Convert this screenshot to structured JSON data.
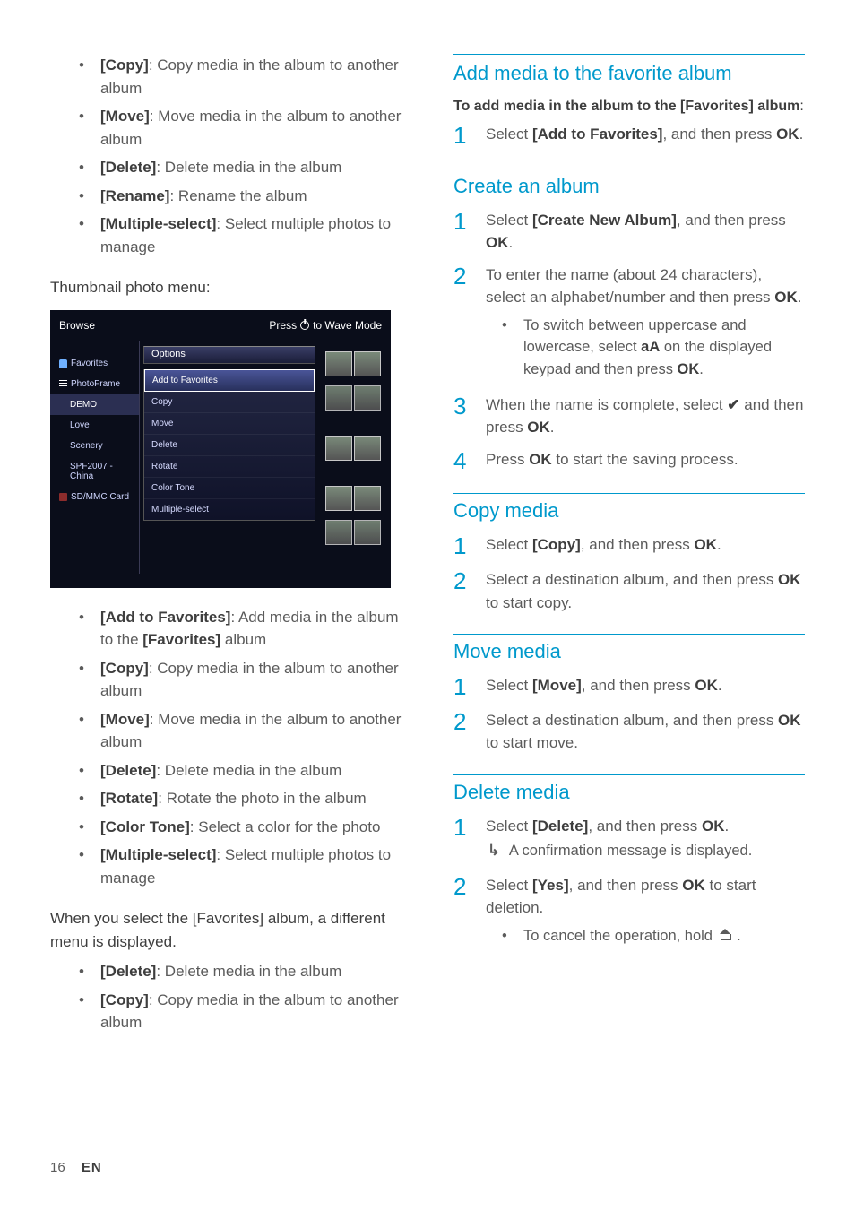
{
  "col1": {
    "list1": [
      {
        "label": "[Copy]",
        "desc": ": Copy media in the album to another album"
      },
      {
        "label": "[Move]",
        "desc": ": Move media in the album to another album"
      },
      {
        "label": "[Delete]",
        "desc": ": Delete media in the album"
      },
      {
        "label": "[Rename]",
        "desc": ": Rename the album"
      },
      {
        "label": "[Multiple-select]",
        "desc": ": Select multiple photos to manage"
      }
    ],
    "thumb_menu_title": "Thumbnail photo menu:",
    "screenshot": {
      "topLeft": "Browse",
      "topRight": "Press        to Wave Mode",
      "left": [
        {
          "label": "Favorites",
          "style": "fav"
        },
        {
          "label": "PhotoFrame",
          "style": "photo"
        },
        {
          "label": "DEMO",
          "style": "indent hl"
        },
        {
          "label": "Love",
          "style": "indent"
        },
        {
          "label": "Scenery",
          "style": "indent"
        },
        {
          "label": "SPF2007 -China",
          "style": "indent"
        },
        {
          "label": "SD/MMC Card",
          "style": "stor"
        }
      ],
      "optionsTitle": "Options",
      "options": [
        "Add to Favorites",
        "Copy",
        "Move",
        "Delete",
        "Rotate",
        "Color Tone",
        "Multiple-select"
      ]
    },
    "list2": [
      {
        "label": "[Add to Favorites]",
        "desc": ": Add media in the album to the ",
        "desc2": "[Favorites]",
        "desc3": " album"
      },
      {
        "label": "[Copy]",
        "desc": ": Copy media in the album to another album"
      },
      {
        "label": "[Move]",
        "desc": ": Move media in the album to another album"
      },
      {
        "label": "[Delete]",
        "desc": ": Delete media in the album"
      },
      {
        "label": "[Rotate]",
        "desc": ": Rotate the photo in the album"
      },
      {
        "label": "[Color Tone]",
        "desc": ": Select a color for the photo"
      },
      {
        "label": "[Multiple-select]",
        "desc": ": Select multiple photos to manage"
      }
    ],
    "fav_note": "When you select the [Favorites] album, a different menu is displayed.",
    "list3": [
      {
        "label": "[Delete]",
        "desc": ": Delete media in the album"
      },
      {
        "label": "[Copy]",
        "desc": ": Copy media in the album to another album"
      }
    ]
  },
  "col2": {
    "s1": {
      "h": "Add media to the favorite album",
      "intro1": "To add media in the album to the ",
      "intro2": "[Favorites]",
      "intro3": " album",
      "step1a": "Select ",
      "step1b": "[Add to Favorites]",
      "step1c": ", and then press ",
      "step1d": "OK",
      "step1e": "."
    },
    "s2": {
      "h": "Create an album",
      "st1a": "Select ",
      "st1b": "[Create New Album]",
      "st1c": ", and then press ",
      "st1d": "OK",
      "st1e": ".",
      "st2a": "To enter the name (about 24 characters), select an alphabet/number and then press ",
      "st2b": "OK",
      "st2c": ".",
      "sub1a": "To switch between uppercase and lowercase, select ",
      "sub1b": "aA",
      "sub1c": " on the displayed keypad and then press ",
      "sub1d": "OK",
      "sub1e": ".",
      "st3a": "When the name is complete, select ",
      "st3c": " and then press ",
      "st3d": "OK",
      "st3e": ".",
      "st4a": "Press ",
      "st4b": "OK",
      "st4c": " to start the saving process."
    },
    "s3": {
      "h": "Copy media",
      "st1a": "Select ",
      "st1b": "[Copy]",
      "st1c": ", and then press ",
      "st1d": "OK",
      "st1e": ".",
      "st2a": "Select a destination album, and then press ",
      "st2b": "OK",
      "st2c": " to start copy."
    },
    "s4": {
      "h": "Move media",
      "st1a": "Select ",
      "st1b": "[Move]",
      "st1c": ", and then press ",
      "st1d": "OK",
      "st1e": ".",
      "st2a": "Select a destination album, and then press ",
      "st2b": "OK",
      "st2c": " to start move."
    },
    "s5": {
      "h": "Delete media",
      "st1a": "Select ",
      "st1b": "[Delete]",
      "st1c": ", and then press ",
      "st1d": "OK",
      "st1e": ".",
      "arrow": "A confirmation message is displayed.",
      "st2a": "Select ",
      "st2b": "[Yes]",
      "st2c": ", and then press ",
      "st2d": "OK",
      "st2e": " to start deletion.",
      "sub1": "To cancel the operation, hold "
    }
  },
  "footer_page": "16",
  "footer_lang": "EN"
}
